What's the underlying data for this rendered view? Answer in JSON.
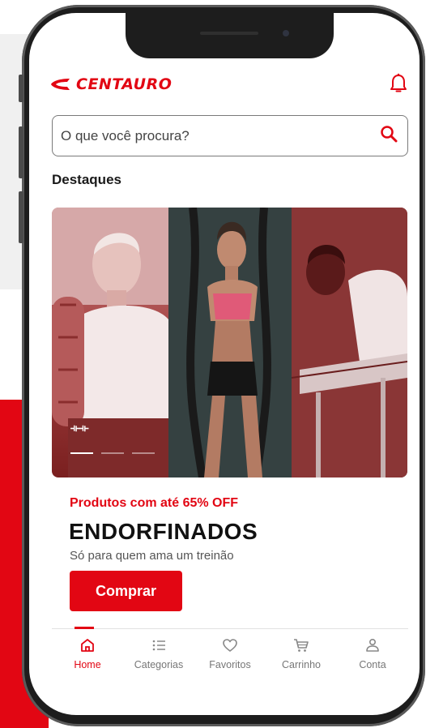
{
  "brand": {
    "name": "CENTAURO",
    "accent": "#e20613"
  },
  "header": {
    "notification_icon": "bell-icon"
  },
  "search": {
    "placeholder": "O que você procura?",
    "icon": "search-icon"
  },
  "section": {
    "title": "Destaques"
  },
  "banner": {
    "logo_text": "⟛⟛",
    "slide_count": 3,
    "active_slide": 1
  },
  "promo": {
    "subtitle": "Produtos com até 65% OFF",
    "title": "ENDORFINADOS",
    "description": "Só para quem ama um treinão",
    "button_label": "Comprar"
  },
  "nav": {
    "items": [
      {
        "label": "Home",
        "icon": "home-icon",
        "active": true
      },
      {
        "label": "Categorias",
        "icon": "list-icon",
        "active": false
      },
      {
        "label": "Favoritos",
        "icon": "heart-icon",
        "active": false
      },
      {
        "label": "Carrinho",
        "icon": "cart-icon",
        "active": false
      },
      {
        "label": "Conta",
        "icon": "user-icon",
        "active": false
      }
    ]
  }
}
